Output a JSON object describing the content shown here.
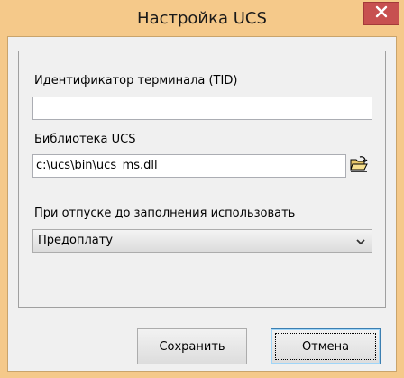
{
  "window": {
    "title": "Настройка UCS"
  },
  "form": {
    "tid_label": "Идентификатор терминала (TID)",
    "tid_value": "",
    "library_label": "Библиотека UCS",
    "library_value": "c:\\ucs\\bin\\ucs_ms.dll",
    "dispense_label": "При отпуске до заполнения использовать",
    "dispense_selected": "Предоплату"
  },
  "buttons": {
    "save_label": "Сохранить",
    "cancel_label": "Отмена"
  },
  "icons": {
    "close": "close-icon",
    "browse": "open-folder-icon",
    "dropdown": "chevron-down-icon"
  },
  "colors": {
    "titlebar": "#f5c98a",
    "close_button": "#c75050",
    "dialog_background": "#f0f0f0",
    "focus_border": "#3c7fb1"
  }
}
